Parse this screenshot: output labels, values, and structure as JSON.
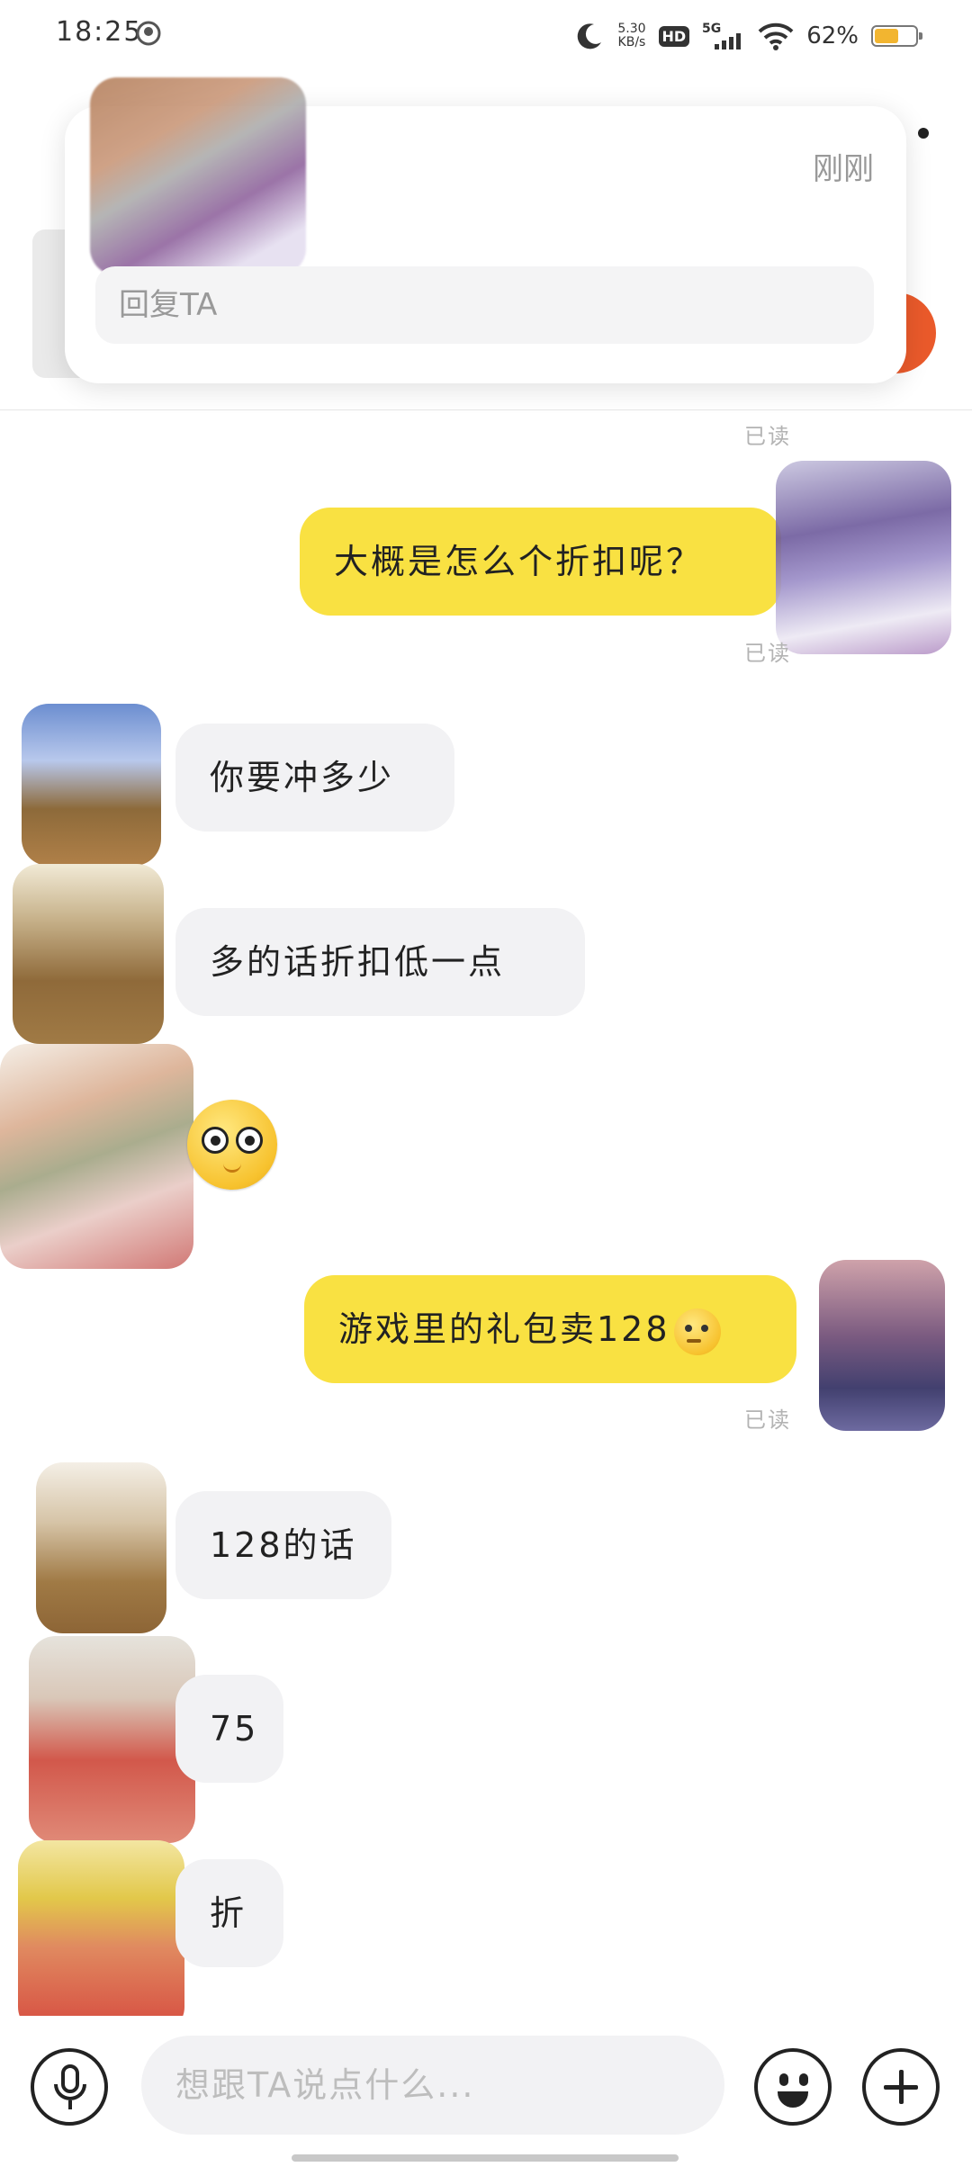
{
  "status_bar": {
    "time": "18:25",
    "net_speed_value": "5.30",
    "net_speed_unit": "KB/s",
    "hd_label": "HD",
    "network": "5G",
    "battery": "62%",
    "battery_level": 0.62
  },
  "notification": {
    "time": "刚刚",
    "reply_placeholder": "回复TA"
  },
  "messages": [
    {
      "side": "out",
      "text": "大概是怎么个折扣呢？",
      "read": "已读"
    },
    {
      "side": "in",
      "text": "你要冲多少"
    },
    {
      "side": "in",
      "text": "多的话折扣低一点"
    },
    {
      "side": "in",
      "emoji": "flushed-face-emoji"
    },
    {
      "side": "out",
      "text": "游戏里的礼包卖128",
      "emoji": "thinking-face-emoji",
      "read": "已读"
    },
    {
      "side": "in",
      "text": "128的话"
    },
    {
      "side": "in",
      "text": "75"
    },
    {
      "side": "in",
      "text": "折"
    }
  ],
  "read_top": "已读",
  "composer": {
    "placeholder": "想跟TA说点什么..."
  },
  "icons": {
    "voice": "microphone-icon",
    "emoji": "smiley-icon",
    "plus": "plus-icon",
    "moon": "moon-icon",
    "wifi": "wifi-icon"
  },
  "colors": {
    "outgoing_bubble": "#f9e142",
    "incoming_bubble": "#f2f2f4",
    "accent_orange": "#ea5a2b",
    "battery": "#f2b530"
  }
}
